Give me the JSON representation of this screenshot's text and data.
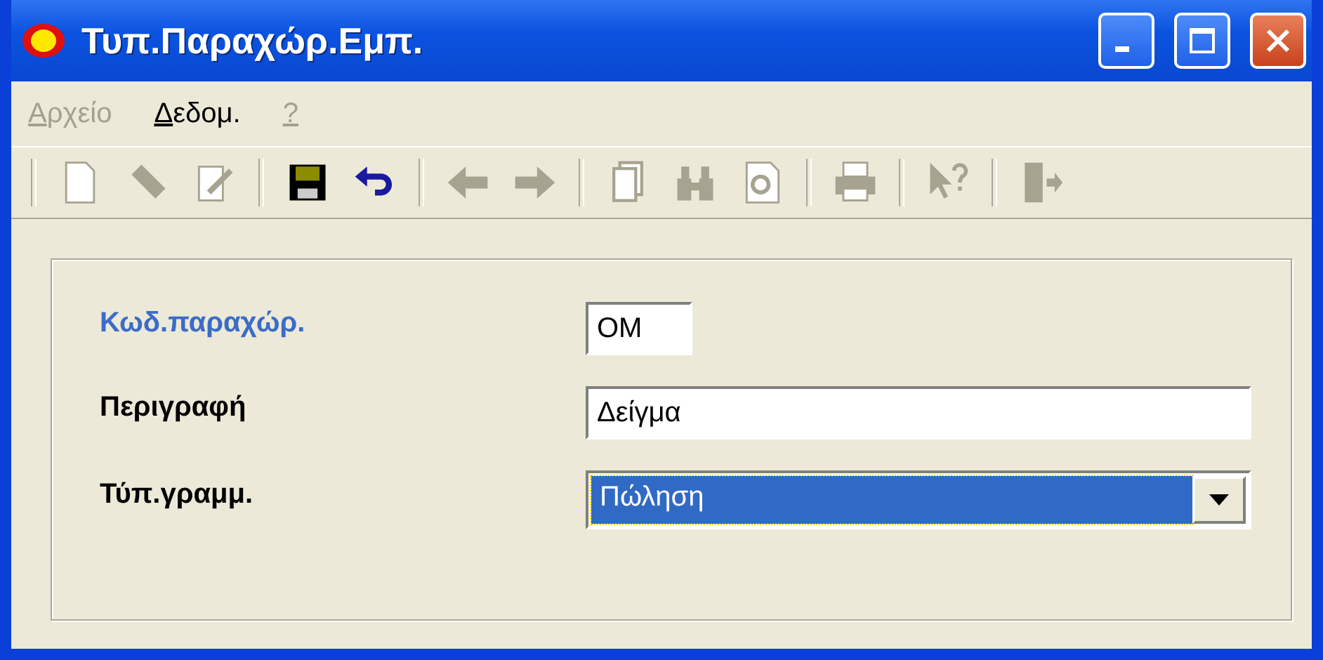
{
  "window": {
    "title": "Τυπ.Παραχώρ.Εμπ."
  },
  "menu": [
    {
      "label": "Αρχείο",
      "disabled": true
    },
    {
      "label": "Δεδομ.",
      "disabled": false
    },
    {
      "label": "?",
      "disabled": true
    }
  ],
  "toolbar": [
    {
      "kind": "separator"
    },
    {
      "kind": "new",
      "disabled": true
    },
    {
      "kind": "eraser",
      "disabled": true
    },
    {
      "kind": "edit",
      "disabled": true
    },
    {
      "kind": "separator"
    },
    {
      "kind": "save",
      "disabled": false
    },
    {
      "kind": "undo",
      "disabled": false
    },
    {
      "kind": "separator"
    },
    {
      "kind": "back",
      "disabled": true
    },
    {
      "kind": "forward",
      "disabled": true
    },
    {
      "kind": "separator"
    },
    {
      "kind": "copy",
      "disabled": true
    },
    {
      "kind": "find",
      "disabled": true
    },
    {
      "kind": "preview",
      "disabled": true
    },
    {
      "kind": "separator"
    },
    {
      "kind": "print",
      "disabled": true
    },
    {
      "kind": "separator"
    },
    {
      "kind": "help",
      "disabled": true
    },
    {
      "kind": "separator"
    },
    {
      "kind": "exit",
      "disabled": true
    }
  ],
  "fields": [
    {
      "kind": "code",
      "label": "Κωδ.παραχώρ.",
      "required": true,
      "value": "ΟΜ"
    },
    {
      "kind": "text",
      "label": "Περιγραφή",
      "required": false,
      "value": "Δείγμα"
    },
    {
      "kind": "dropdown",
      "label": "Τύπ.γραμμ.",
      "required": false,
      "value": "Πώληση",
      "focused": true
    }
  ]
}
